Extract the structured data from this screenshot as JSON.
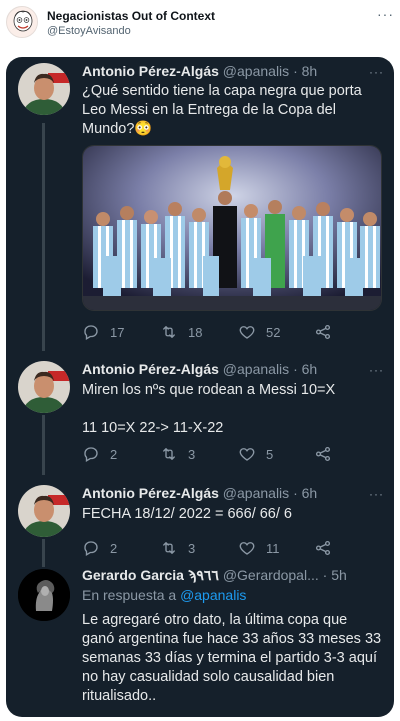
{
  "header": {
    "name": "Negacionistas Out of Context",
    "handle": "@EstoyAvisando",
    "more": "···"
  },
  "tweets": [
    {
      "name": "Antonio Pérez-Algás",
      "handle": "@apanalis",
      "time": "8h",
      "text": "¿Qué sentido tiene la capa negra que porta Leo Messi en la Entrega de la Copa del Mundo?😳",
      "replies": "17",
      "retweets": "18",
      "likes": "52"
    },
    {
      "name": "Antonio Pérez-Algás",
      "handle": "@apanalis",
      "time": "6h",
      "text": "Miren los nºs que rodean a Messi 10=X\n\n11 10=X 22->  11-X-22",
      "replies": "2",
      "retweets": "3",
      "likes": "5"
    },
    {
      "name": "Antonio Pérez-Algás",
      "handle": "@apanalis",
      "time": "6h",
      "text": "FECHA 18/12/ 2022 = 666/ 66/ 6",
      "replies": "2",
      "retweets": "3",
      "likes": "11"
    },
    {
      "name": "Gerardo Garcia ϡ٩٦٦",
      "handle": "@Gerardopal...",
      "time": "5h",
      "reply_prefix": "En respuesta a",
      "reply_to": "@apanalis",
      "text": "Le agregaré otro dato, la última copa que ganó argentina fue hace 33 años 33 meses 33 semanas 33 días y termina el partido 3-3 aquí no hay casualidad solo causalidad bien ritualisado.."
    }
  ],
  "separator": "·",
  "more": "···",
  "colors": {
    "background": "#15202b",
    "text": "#e7e9ea",
    "secondary": "#8b98a5",
    "accent": "#1d9bf0"
  },
  "icons": [
    "reply-icon",
    "retweet-icon",
    "like-icon",
    "share-icon",
    "more-icon"
  ]
}
